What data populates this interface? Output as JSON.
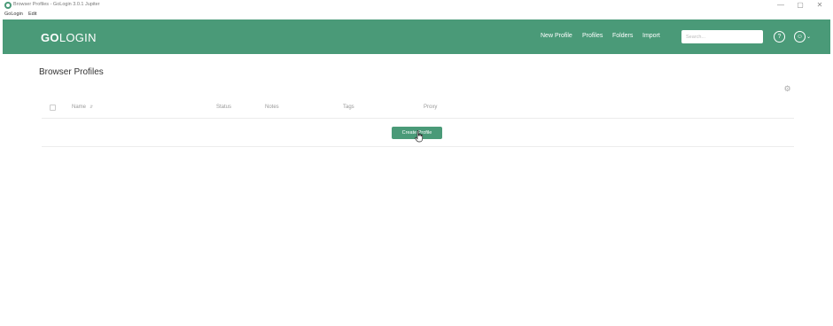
{
  "window": {
    "title": "Browser Profiles - GoLogin 3.0.1 Jupiter",
    "controls": {
      "minimize": "—",
      "maximize": "▢",
      "close": "✕"
    }
  },
  "menu": [
    "GoLogin",
    "Edit"
  ],
  "header": {
    "logo_bold": "GO",
    "logo_rest": "LOGIN",
    "nav": [
      "New Profile",
      "Profiles",
      "Folders",
      "Import"
    ],
    "search_placeholder": "Search...",
    "support_icon_glyph": "?",
    "user_icon_glyph": "☺",
    "user_caret": "⌄",
    "accent_color": "#4a9a78"
  },
  "main": {
    "title": "Browser Profiles",
    "settings_icon_glyph": "⚙",
    "columns": [
      "Name",
      "Status",
      "Notes",
      "Tags",
      "Proxy"
    ],
    "sort_glyph": "⇵",
    "create_button": "Create Profile"
  }
}
